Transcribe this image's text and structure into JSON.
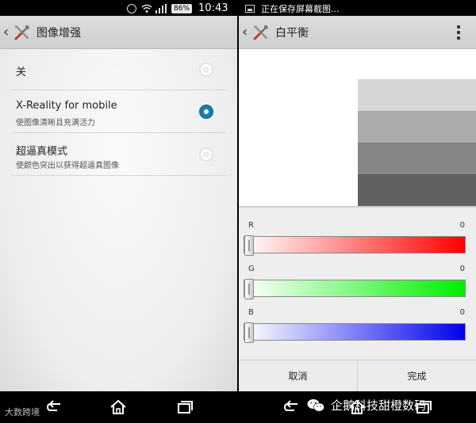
{
  "left": {
    "status": {
      "battery": "86%",
      "time": "10:43"
    },
    "title": "图像增强",
    "options": [
      {
        "title": "关",
        "subtitle": "",
        "selected": false
      },
      {
        "title": "X-Reality for mobile",
        "subtitle": "使图像清晰且充满活力",
        "selected": true
      },
      {
        "title": "超逼真模式",
        "subtitle": "使颜色突出以获得超逼真图像",
        "selected": false
      }
    ],
    "watermark": "大数跨境"
  },
  "right": {
    "status": {
      "text": "正在保存屏幕截图..."
    },
    "title": "白平衡",
    "sliders": [
      {
        "label": "R",
        "value": "0",
        "color": "#ff0000"
      },
      {
        "label": "G",
        "value": "0",
        "color": "#00ee00"
      },
      {
        "label": "B",
        "value": "0",
        "color": "#0000ee"
      }
    ],
    "buttons": {
      "cancel": "取消",
      "done": "完成"
    },
    "watermark": "企鹅科技甜橙数码"
  },
  "colors": {
    "radio_selected": "#1f7cad",
    "gray_bars": [
      "#d6d6d6",
      "#ababab",
      "#858585",
      "#616161"
    ]
  },
  "icons": [
    "tools-icon",
    "overflow-menu-icon",
    "back-icon",
    "home-icon",
    "recents-icon",
    "wechat-icon"
  ]
}
